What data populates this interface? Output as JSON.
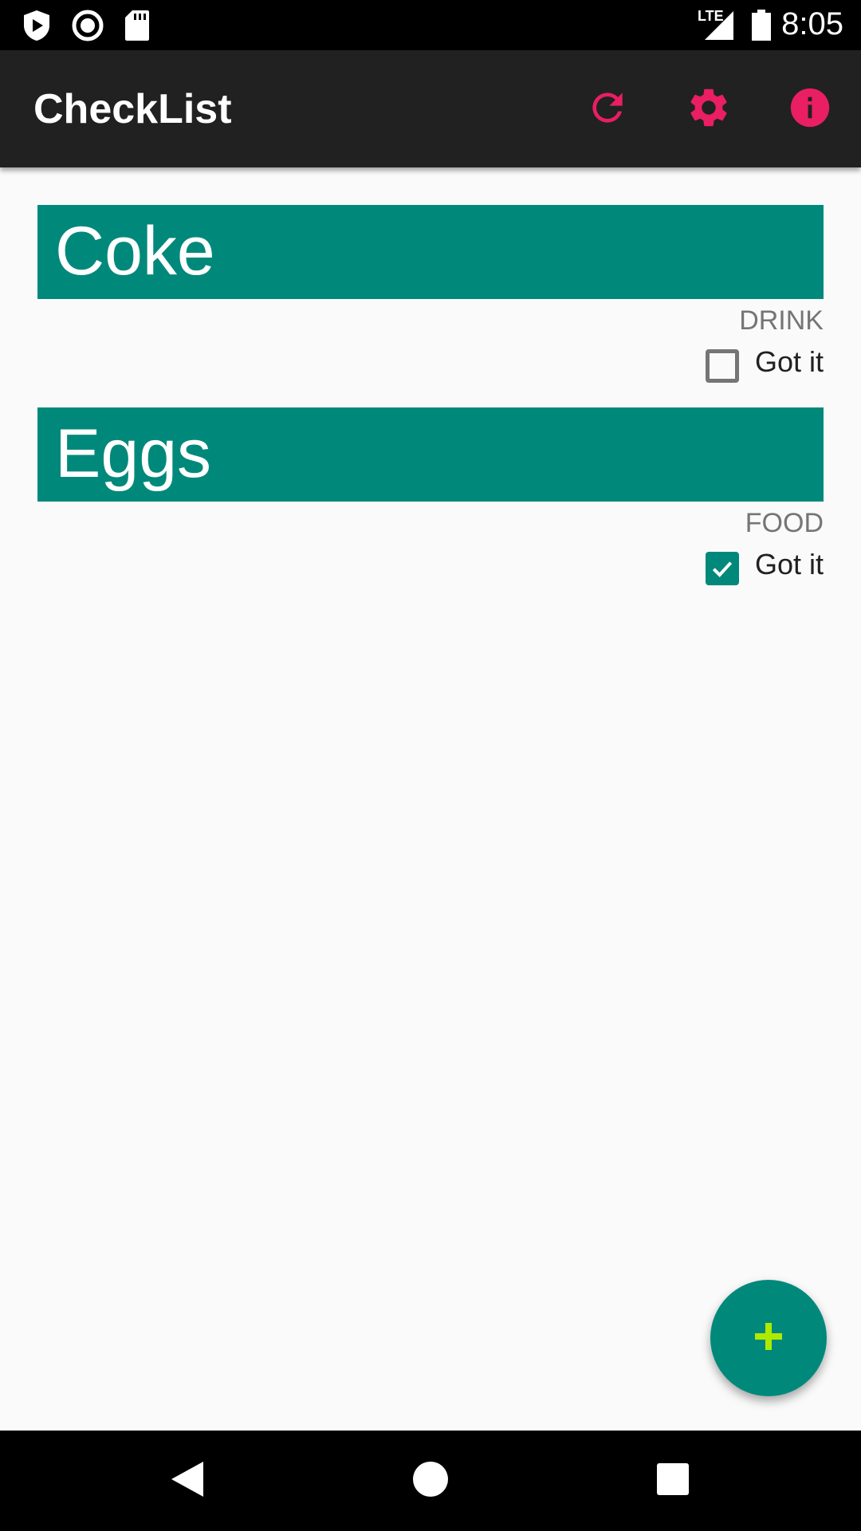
{
  "status_bar": {
    "time": "8:05",
    "network_label": "LTE",
    "icons": [
      "play-protect-icon",
      "record-icon",
      "sd-card-icon",
      "signal-icon",
      "battery-icon"
    ]
  },
  "app_bar": {
    "title": "CheckList",
    "actions": [
      "refresh-icon",
      "settings-icon",
      "info-icon"
    ]
  },
  "items": [
    {
      "name": "Coke",
      "category": "DRINK",
      "check_label": "Got it",
      "checked": false
    },
    {
      "name": "Eggs",
      "category": "FOOD",
      "check_label": "Got it",
      "checked": true
    }
  ],
  "fab": {
    "icon": "add-icon"
  },
  "nav_bar": {
    "buttons": [
      "back-icon",
      "home-icon",
      "recents-icon"
    ]
  },
  "colors": {
    "accent": "#e91e63",
    "primary": "#00897b",
    "app_bar": "#212121",
    "background": "#fafafa",
    "fab_plus": "#aeea00"
  }
}
